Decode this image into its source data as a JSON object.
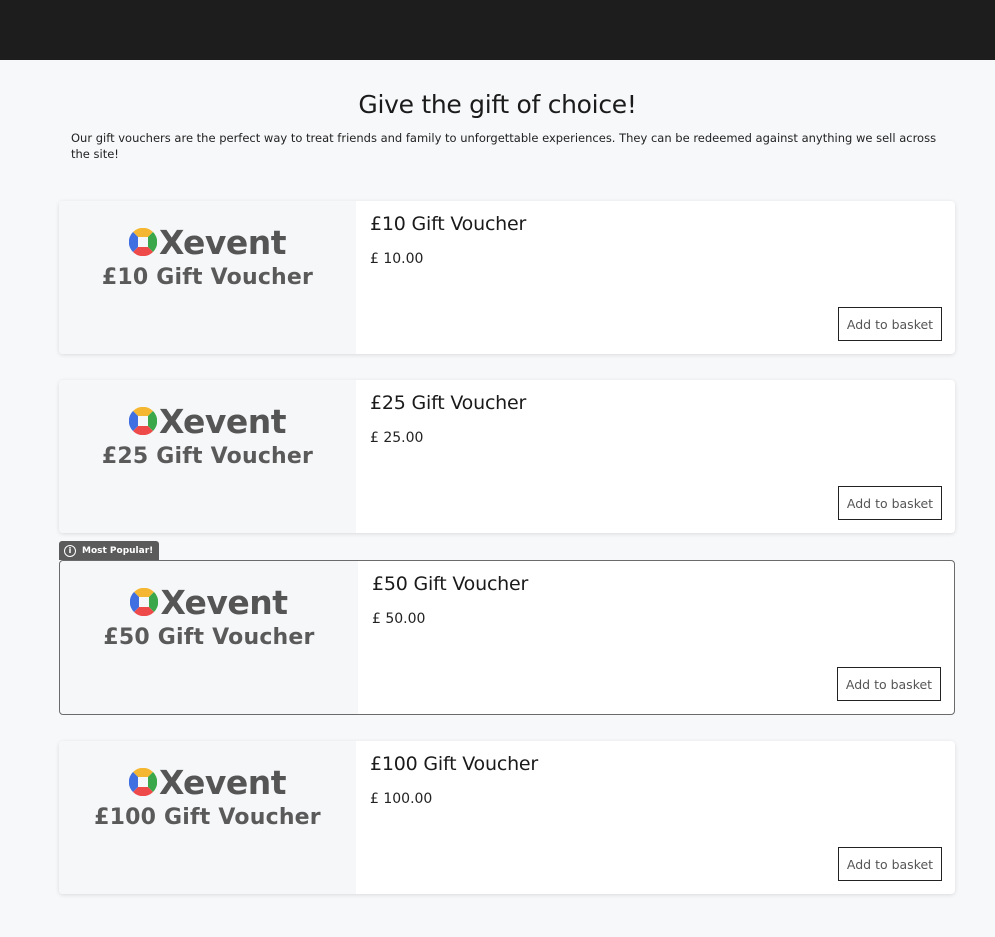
{
  "header": {
    "title": "Give the gift of choice!",
    "intro": "Our gift vouchers are the perfect way to treat friends and family to unforgettable experiences. They can be redeemed against anything we sell across the site!"
  },
  "brand": {
    "name": "Xevent"
  },
  "badge": {
    "label": "Most Popular!"
  },
  "vouchers": [
    {
      "image_title": "£10 Gift Voucher",
      "name": "£10 Gift Voucher",
      "price": "£ 10.00",
      "button": "Add to basket"
    },
    {
      "image_title": "£25 Gift Voucher",
      "name": "£25 Gift Voucher",
      "price": "£ 25.00",
      "button": "Add to basket"
    },
    {
      "image_title": "£50 Gift Voucher",
      "name": "£50 Gift Voucher",
      "price": "£ 50.00",
      "button": "Add to basket",
      "popular": true
    },
    {
      "image_title": "£100 Gift Voucher",
      "name": "£100 Gift Voucher",
      "price": "£ 100.00",
      "button": "Add to basket"
    }
  ],
  "colors": {
    "topbar": "#1d1d1d",
    "logo_yellow": "#f5b731",
    "logo_green": "#3aa84a",
    "logo_red": "#ef4a4a",
    "logo_blue": "#3f6fe0"
  }
}
